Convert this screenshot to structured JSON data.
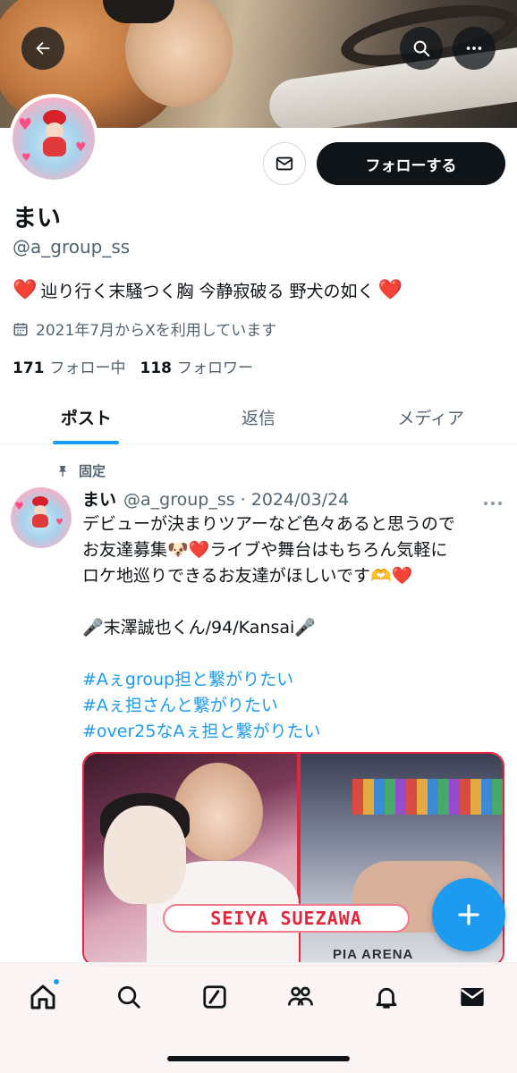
{
  "header": {
    "back_icon": "arrow-left-icon",
    "search_icon": "search-icon",
    "more_icon": "ellipsis-icon"
  },
  "profile": {
    "name": "まい",
    "handle": "@a_group_ss",
    "bio_text": "辿り行く末騒つく胸 今静寂破る 野犬の如く",
    "bio_heart": "❤️",
    "joined": "2021年7月からXを利用しています",
    "following_count": "171",
    "following_label": "フォロー中",
    "followers_count": "118",
    "followers_label": "フォロワー",
    "follow_button": "フォローする"
  },
  "tabs": [
    {
      "label": "ポスト",
      "active": true
    },
    {
      "label": "返信",
      "active": false
    },
    {
      "label": "メディア",
      "active": false
    }
  ],
  "post": {
    "pinned_label": "固定",
    "author": "まい",
    "meta": "@a_group_ss · 2024/03/24",
    "lines": [
      "デビューが決まりツアーなど色々あると思うので",
      "お友達募集🐶❤️ライブや舞台はもちろん気軽に",
      "ロケ地巡りできるお友達がほしいです🫶❤️",
      "",
      "🎤末澤誠也くん/94/Kansai🎤",
      ""
    ],
    "hashtags": [
      "#Aぇgroup担と繋がりたい",
      "#Aぇ担さんと繋がりたい",
      "#over25なAぇ担と繋がりたい"
    ],
    "media": {
      "label_text": "SEIYA SUEZAWA",
      "arena_text": "PIA ARENA"
    }
  },
  "nav": {
    "items": [
      "home-icon",
      "search-icon",
      "grok-icon",
      "communities-icon",
      "notifications-icon",
      "messages-icon"
    ]
  },
  "colors": {
    "accent": "#1d9bf0",
    "text": "#0f1419",
    "secondary": "#536471",
    "heart": "#e0243a"
  }
}
